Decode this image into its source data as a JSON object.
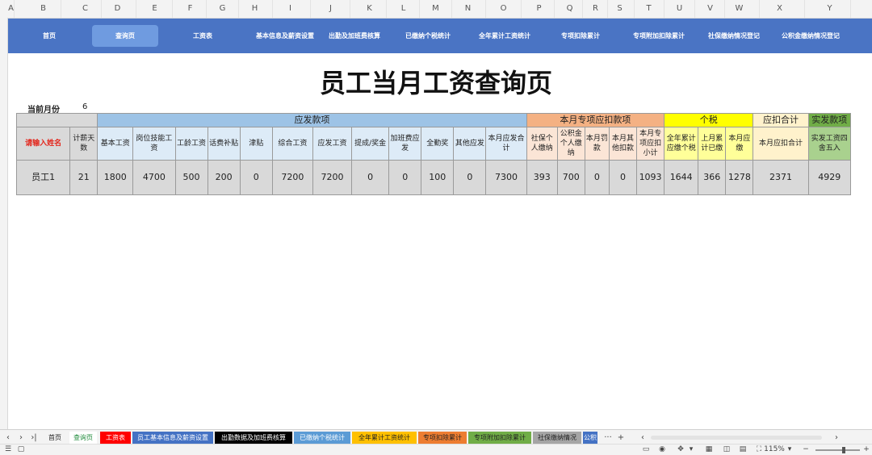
{
  "column_headers": [
    "A",
    "B",
    "C",
    "D",
    "E",
    "F",
    "G",
    "H",
    "I",
    "J",
    "K",
    "L",
    "M",
    "N",
    "O",
    "P",
    "Q",
    "R",
    "S",
    "T",
    "U",
    "V",
    "W",
    "X",
    "Y"
  ],
  "nav": {
    "items": [
      {
        "label": "首页"
      },
      {
        "label": "查询页"
      },
      {
        "label": "工资表"
      },
      {
        "label": "基本信息及薪资设置"
      },
      {
        "label": "出勤及加班费核算"
      },
      {
        "label": "已缴纳个税统计"
      },
      {
        "label": "全年累计工资统计"
      },
      {
        "label": "专项扣除累计"
      },
      {
        "label": "专项附加扣除累计"
      },
      {
        "label": "社保缴纳情况登记"
      },
      {
        "label": "公积金缴纳情况登记"
      }
    ],
    "active_index": 1
  },
  "title": "员工当月工资查询页",
  "current_month_label": "当前月份",
  "current_month_value": "6",
  "groups": {
    "yingfa": "应发款项",
    "zhuanxiang": "本月专项应扣款项",
    "geshui": "个税",
    "yingkou": "应扣合计",
    "shifa": "实发款项"
  },
  "headers": [
    "请输入姓名",
    "计薪天数",
    "基本工资",
    "岗位技能工资",
    "工龄工资",
    "话费补贴",
    "津贴",
    "综合工资",
    "应发工资",
    "提成/奖金",
    "加班费应发",
    "全勤奖",
    "其他应发",
    "本月应发合计",
    "社保个人缴纳",
    "公积金个人缴纳",
    "本月罚款",
    "本月其他扣款",
    "本月专项应扣小计",
    "全年累计应缴个税",
    "上月累计已缴",
    "本月应缴",
    "本月应扣合计",
    "实发工资四舍五入"
  ],
  "row": [
    "员工1",
    "21",
    "1800",
    "4700",
    "500",
    "200",
    "0",
    "7200",
    "7200",
    "0",
    "0",
    "100",
    "0",
    "7300",
    "393",
    "700",
    "0",
    "0",
    "1093",
    "1644",
    "366",
    "1278",
    "2371",
    "4929"
  ],
  "sheet_tabs": [
    {
      "label": "首页"
    },
    {
      "label": "查询页"
    },
    {
      "label": "工资表"
    },
    {
      "label": "员工基本信息及薪资设置"
    },
    {
      "label": "出勤数据及加班费核算"
    },
    {
      "label": "已缴纳个税统计"
    },
    {
      "label": "全年累计工资统计"
    },
    {
      "label": "专项扣除累计"
    },
    {
      "label": "专项附加扣除累计"
    },
    {
      "label": "社保缴纳情况"
    },
    {
      "label": "公积"
    }
  ],
  "sheet_tab_colors": [
    "#f3f3f3",
    "#ffffff",
    "#ff0000",
    "#4472c4",
    "#000000",
    "#5b9bd5",
    "#ffc000",
    "#ed7d31",
    "#70ad47",
    "#a5a5a5",
    "#4472c4"
  ],
  "tab_more": "···",
  "tab_add": "+",
  "zoom": "115%",
  "colors": {
    "nav_bg": "#4a74c4",
    "nav_active": "#6f9be0",
    "group_blue": "#9dc3e6",
    "group_orange": "#f4b183",
    "group_yellow": "#ffff00",
    "group_cream": "#fff2cc",
    "group_green": "#70ad47",
    "name_prompt": "#e3251b"
  }
}
